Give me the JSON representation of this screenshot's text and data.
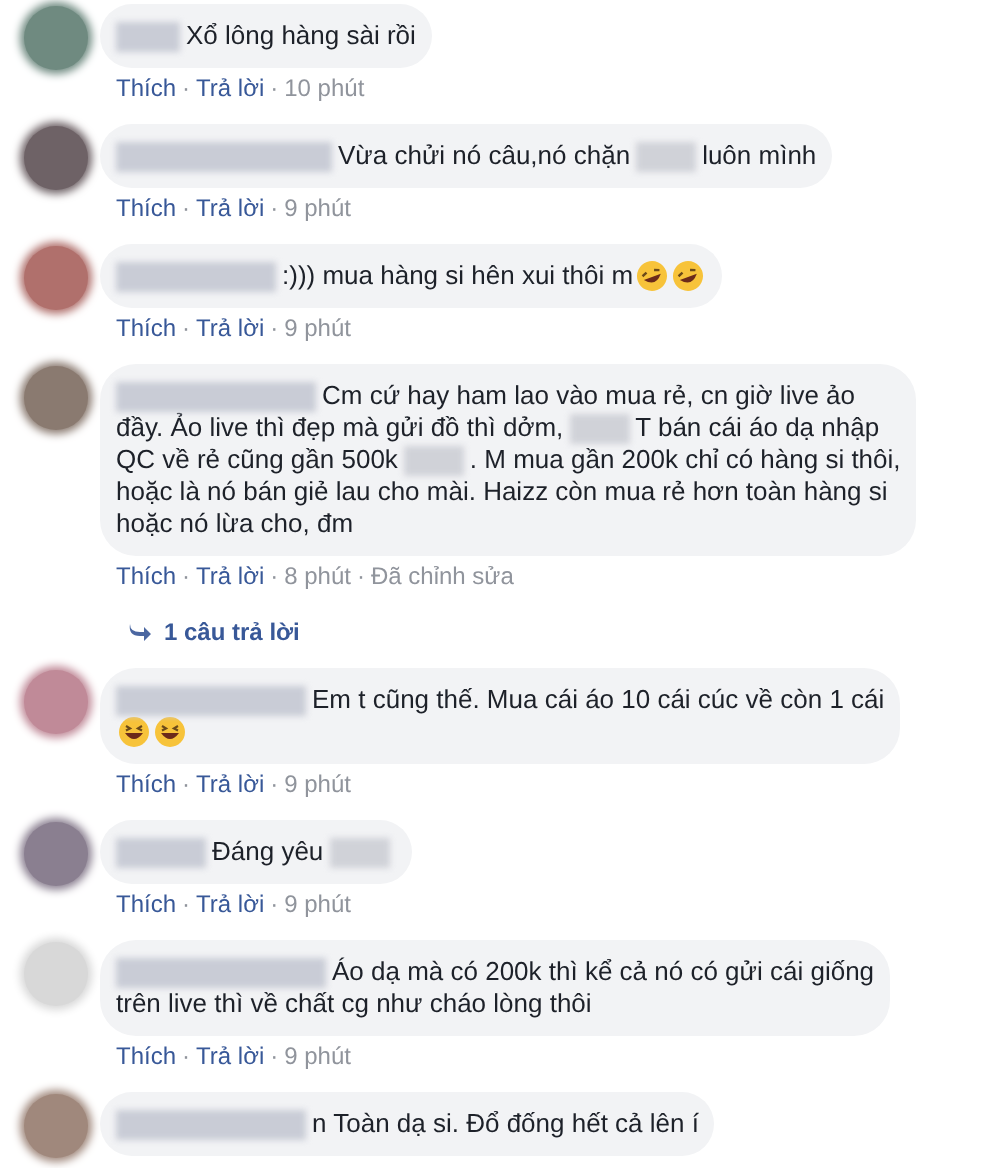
{
  "comments": [
    {
      "avatar": {
        "color": "#6f8a80"
      },
      "lines": [
        [
          {
            "kind": "text",
            "text": "Xổ lông hàng sài rồi"
          }
        ]
      ],
      "actions": [
        {
          "kind": "like",
          "text": "Thích"
        },
        {
          "kind": "separator",
          "text": "·"
        },
        {
          "kind": "reply",
          "text": "Trả lời"
        },
        {
          "kind": "separator",
          "text": "·"
        },
        {
          "kind": "time",
          "text": "10 phút"
        }
      ]
    },
    {
      "avatar": {
        "color": "#6e6266"
      },
      "lines": [
        [
          {
            "kind": "text",
            "text": "Vừa chửi nó câu,nó chặn"
          },
          {
            "kind": "redacted"
          },
          {
            "kind": "text",
            "text": "luôn mình"
          }
        ]
      ],
      "actions": [
        {
          "kind": "like",
          "text": "Thích"
        },
        {
          "kind": "separator",
          "text": "·"
        },
        {
          "kind": "reply",
          "text": "Trả lời"
        },
        {
          "kind": "separator",
          "text": "·"
        },
        {
          "kind": "time",
          "text": "9 phút"
        }
      ]
    },
    {
      "avatar": {
        "color": "#b0706c"
      },
      "lines": [
        [
          {
            "kind": "text",
            "text": ":))) mua hàng si hên xui thôi m"
          },
          {
            "kind": "emoji"
          },
          {
            "kind": "emoji"
          }
        ]
      ],
      "actions": [
        {
          "kind": "like",
          "text": "Thích"
        },
        {
          "kind": "separator",
          "text": "·"
        },
        {
          "kind": "reply",
          "text": "Trả lời"
        },
        {
          "kind": "separator",
          "text": "·"
        },
        {
          "kind": "time",
          "text": "9 phút"
        }
      ]
    },
    {
      "avatar": {
        "color": "#8a7a70"
      },
      "lines": [
        [
          {
            "kind": "text",
            "text": "Cm cứ hay ham lao vào mua rẻ, cn giờ live ảo"
          }
        ],
        [
          {
            "kind": "text",
            "text": "đầy. Ảo live thì đẹp mà gửi đồ thì dởm,"
          },
          {
            "kind": "redacted"
          },
          {
            "kind": "text",
            "text": "T bán cái áo dạ nhập"
          }
        ],
        [
          {
            "kind": "text",
            "text": "QC về rẻ cũng gần 500k"
          },
          {
            "kind": "redacted"
          },
          {
            "kind": "text",
            "text": ". M mua gần 200k chỉ có hàng si thôi,"
          }
        ],
        [
          {
            "kind": "text",
            "text": "hoặc là nó bán giẻ lau cho mài. Haizz còn mua rẻ hơn toàn hàng si"
          }
        ],
        [
          {
            "kind": "text",
            "text": "hoặc nó lừa cho, đm"
          }
        ]
      ],
      "actions": [
        {
          "kind": "like",
          "text": "Thích"
        },
        {
          "kind": "separator",
          "text": "·"
        },
        {
          "kind": "reply",
          "text": "Trả lời"
        },
        {
          "kind": "separator",
          "text": "·"
        },
        {
          "kind": "time",
          "text": "8 phút"
        },
        {
          "kind": "separator",
          "text": "·"
        },
        {
          "kind": "edited",
          "text": "Đã chỉnh sửa"
        }
      ],
      "replies_link": "1 câu trả lời"
    },
    {
      "avatar": {
        "color": "#c08a98"
      },
      "lines": [
        [
          {
            "kind": "text",
            "text": "Em t cũng thế. Mua cái áo 10 cái cúc về còn 1 cái"
          }
        ],
        [
          {
            "kind": "emoji_grin"
          },
          {
            "kind": "emoji_grin"
          }
        ]
      ],
      "actions": [
        {
          "kind": "like",
          "text": "Thích"
        },
        {
          "kind": "separator",
          "text": "·"
        },
        {
          "kind": "reply",
          "text": "Trả lời"
        },
        {
          "kind": "separator",
          "text": "·"
        },
        {
          "kind": "time",
          "text": "9 phút"
        }
      ]
    },
    {
      "avatar": {
        "color": "#8a7f90"
      },
      "lines": [
        [
          {
            "kind": "text",
            "text": "Đáng yêu"
          },
          {
            "kind": "redacted"
          }
        ]
      ],
      "actions": [
        {
          "kind": "like",
          "text": "Thích"
        },
        {
          "kind": "separator",
          "text": "·"
        },
        {
          "kind": "reply",
          "text": "Trả lời"
        },
        {
          "kind": "separator",
          "text": "·"
        },
        {
          "kind": "time",
          "text": "9 phút"
        }
      ]
    },
    {
      "avatar": {
        "color": "#d8d8d8"
      },
      "lines": [
        [
          {
            "kind": "text",
            "text": "Áo dạ mà có 200k thì kể cả nó có gửi cái giống"
          }
        ],
        [
          {
            "kind": "text",
            "text": "trên live thì về chất cg như cháo lòng thôi"
          }
        ]
      ],
      "actions": [
        {
          "kind": "like",
          "text": "Thích"
        },
        {
          "kind": "separator",
          "text": "·"
        },
        {
          "kind": "reply",
          "text": "Trả lời"
        },
        {
          "kind": "separator",
          "text": "·"
        },
        {
          "kind": "time",
          "text": "9 phút"
        }
      ]
    },
    {
      "avatar": {
        "color": "#a0887c"
      },
      "lines": [
        [
          {
            "kind": "text",
            "text": "n Toàn dạ si. Đổ đống hết cả lên í"
          }
        ]
      ]
    }
  ]
}
